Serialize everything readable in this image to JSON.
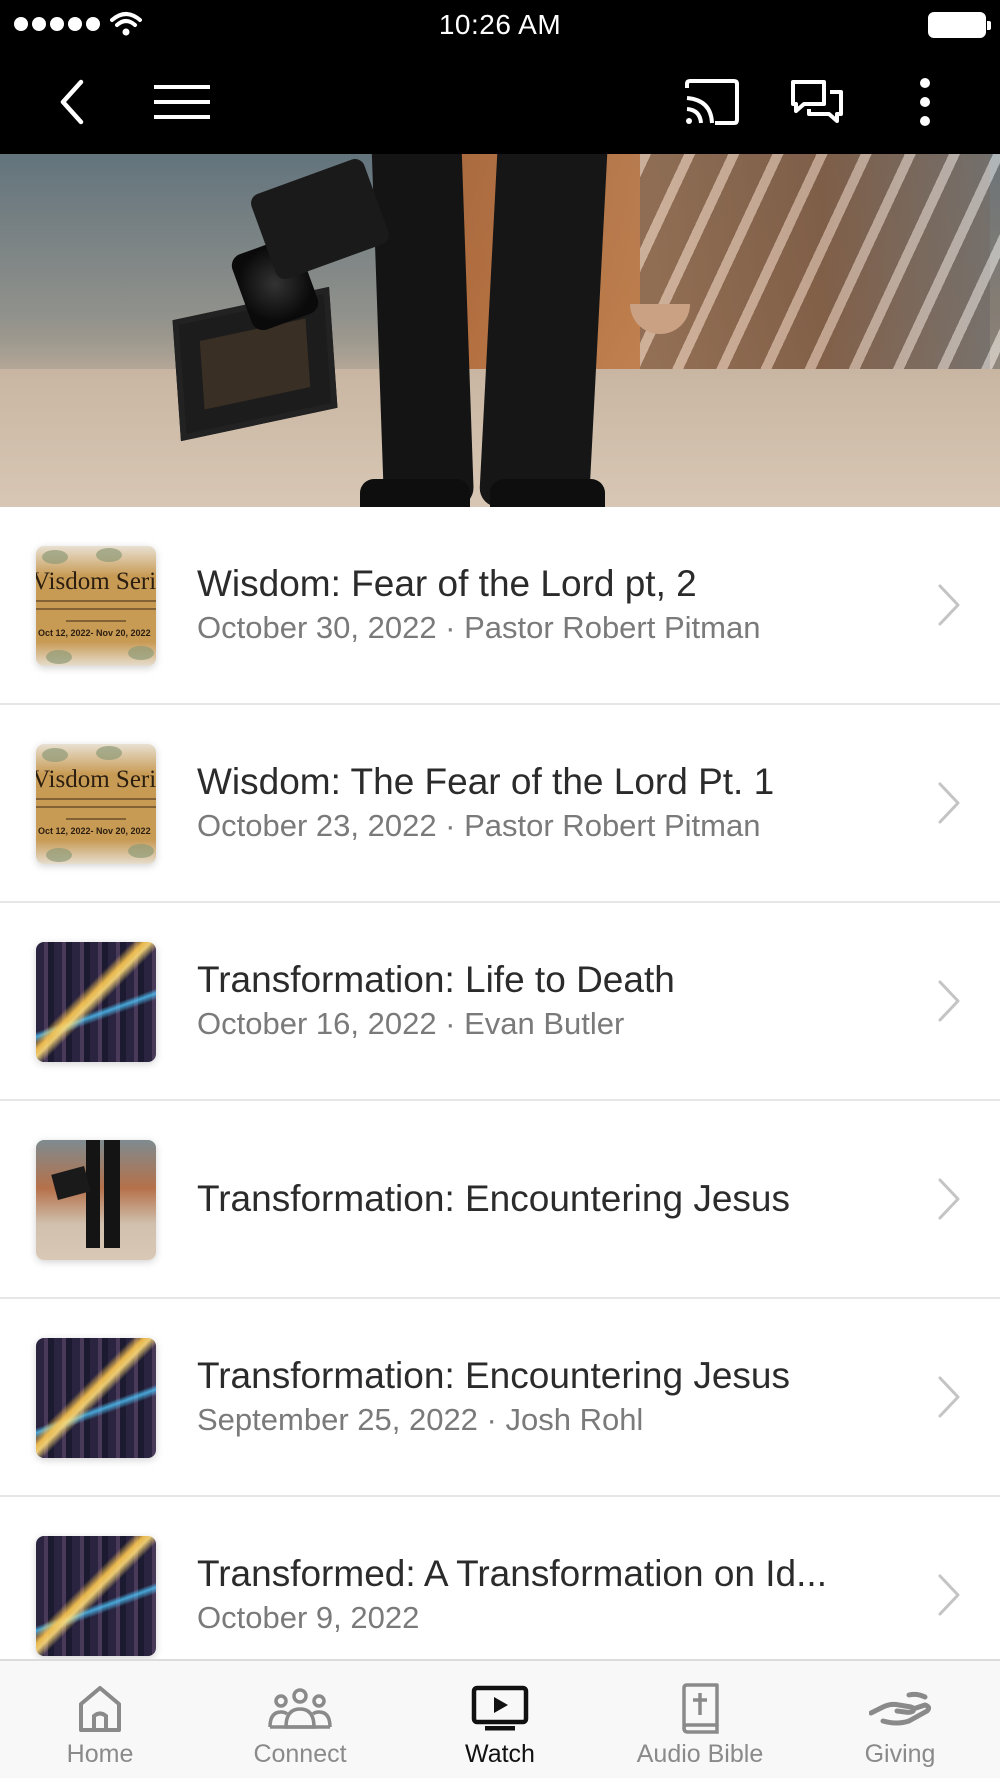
{
  "status_bar": {
    "time": "10:26 AM"
  },
  "nav": {
    "back_icon": "chevron-left-icon",
    "menu_icon": "hamburger-icon",
    "cast_icon": "cast-icon",
    "chat_icon": "chat-icon",
    "more_icon": "more-vertical-icon"
  },
  "colors": {
    "nav_bg": "#000000",
    "text_primary": "#2b2b2b",
    "text_secondary": "#7a7a7a",
    "tab_active": "#111111",
    "tab_inactive": "#8a8a8a"
  },
  "sermons": [
    {
      "title": "Wisdom: Fear of the Lord pt, 2",
      "subtitle": "October 30, 2022 · Pastor Robert Pitman",
      "thumb": "wisdom",
      "thumb_text": {
        "title": "Visdom Seri",
        "line1": "he book of Proverbs and what it teach",
        "line2": "s that lead to a peaceful and a prospe",
        "line3": "Read a Proverb a day",
        "dates": "Oct 12, 2022- Nov 20, 2022"
      }
    },
    {
      "title": "Wisdom: The Fear of the Lord Pt. 1",
      "subtitle": "October 23, 2022 · Pastor Robert Pitman",
      "thumb": "wisdom",
      "thumb_text": {
        "title": "Visdom Seri",
        "line1": "he book of Proverbs and what it teach",
        "line2": "s that lead to a peaceful and a prospe",
        "line3": "Read a Proverb a day",
        "dates": "Oct 12, 2022- Nov 20, 2022"
      }
    },
    {
      "title": "Transformation: Life to Death",
      "subtitle": "October 16, 2022 · Evan Butler",
      "thumb": "city"
    },
    {
      "title": "Transformation: Encountering Jesus",
      "subtitle": "",
      "thumb": "legs"
    },
    {
      "title": "Transformation: Encountering Jesus",
      "subtitle": "September 25, 2022 · Josh Rohl",
      "thumb": "city"
    },
    {
      "title": "Transformed: A Transformation on Id...",
      "subtitle": "October 9, 2022",
      "thumb": "city"
    }
  ],
  "tabs": [
    {
      "label": "Home",
      "icon": "home-icon",
      "active": false
    },
    {
      "label": "Connect",
      "icon": "people-icon",
      "active": false
    },
    {
      "label": "Watch",
      "icon": "tv-play-icon",
      "active": true
    },
    {
      "label": "Audio Bible",
      "icon": "bible-icon",
      "active": false
    },
    {
      "label": "Giving",
      "icon": "giving-hand-icon",
      "active": false
    }
  ]
}
